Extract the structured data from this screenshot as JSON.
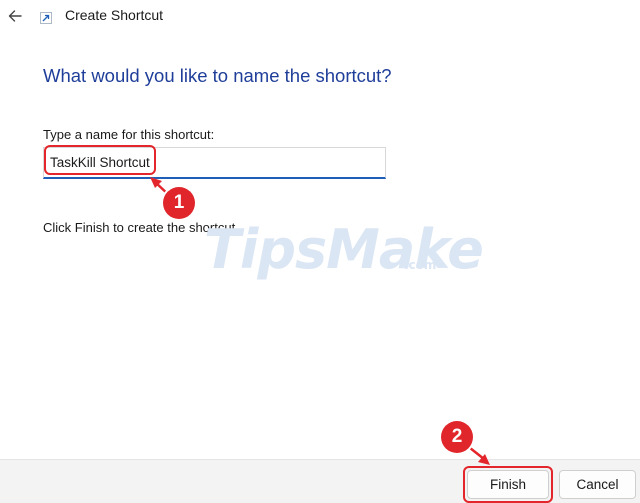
{
  "window": {
    "title": "Create Shortcut",
    "back_icon": "arrow-left-icon",
    "shortcut_icon": "shortcut-arrow-icon"
  },
  "main": {
    "heading": "What would you like to name the shortcut?",
    "field_label": "Type a name for this shortcut:",
    "field_value": "TaskKill Shortcut",
    "hint": "Click Finish to create the shortcut."
  },
  "footer": {
    "finish_label": "Finish",
    "cancel_label": "Cancel"
  },
  "annotations": [
    {
      "number": "1",
      "target": "name-input"
    },
    {
      "number": "2",
      "target": "finish-button"
    }
  ],
  "watermark": {
    "text": "TipsMake",
    "suffix": ".com"
  },
  "colors": {
    "heading": "#1f3e99",
    "input_underline": "#1f5fb8",
    "annotation": "#e3262b",
    "footer_bg": "#f3f3f3"
  }
}
